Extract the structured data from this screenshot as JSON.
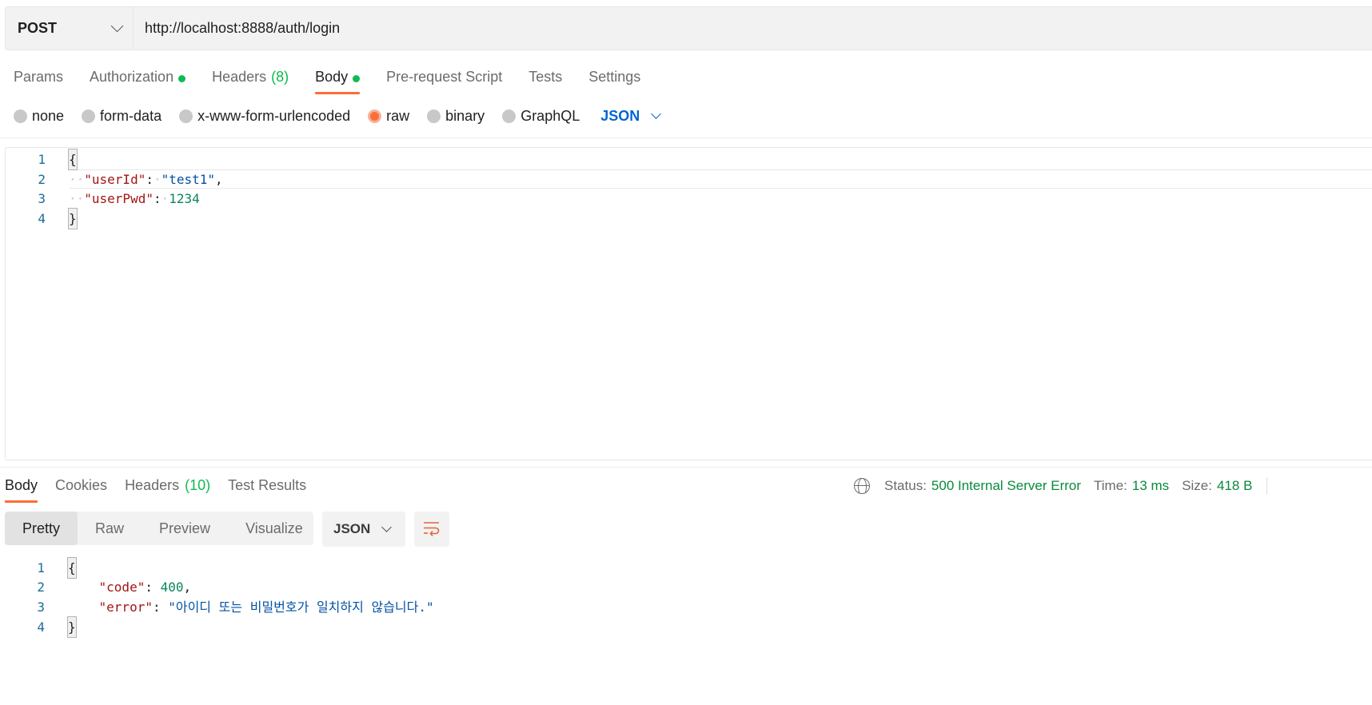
{
  "request": {
    "method": "POST",
    "url": "http://localhost:8888/auth/login"
  },
  "request_tabs": [
    {
      "label": "Params",
      "dot": false
    },
    {
      "label": "Authorization",
      "dot": true
    },
    {
      "label": "Headers",
      "count": "(8)"
    },
    {
      "label": "Body",
      "dot": true,
      "active": true
    },
    {
      "label": "Pre-request Script"
    },
    {
      "label": "Tests"
    },
    {
      "label": "Settings"
    }
  ],
  "body_types": [
    {
      "label": "none",
      "checked": false
    },
    {
      "label": "form-data",
      "checked": false
    },
    {
      "label": "x-www-form-urlencoded",
      "checked": false
    },
    {
      "label": "raw",
      "checked": true
    },
    {
      "label": "binary",
      "checked": false
    },
    {
      "label": "GraphQL",
      "checked": false
    }
  ],
  "raw_language": "JSON",
  "request_body": {
    "line_numbers": [
      "1",
      "2",
      "3",
      "4"
    ],
    "open_brace": "{",
    "close_brace": "}",
    "key1": "\"userId\"",
    "val1": "\"test1\"",
    "key2": "\"userPwd\"",
    "val2": "1234"
  },
  "response_tabs": [
    {
      "label": "Body",
      "active": true
    },
    {
      "label": "Cookies"
    },
    {
      "label": "Headers",
      "count": "(10)"
    },
    {
      "label": "Test Results"
    }
  ],
  "response_status": {
    "status_label": "Status:",
    "status_value": "500 Internal Server Error",
    "time_label": "Time:",
    "time_value": "13 ms",
    "size_label": "Size:",
    "size_value": "418 B"
  },
  "view_modes": [
    "Pretty",
    "Raw",
    "Preview",
    "Visualize"
  ],
  "response_format": "JSON",
  "response_body": {
    "line_numbers": [
      "1",
      "2",
      "3",
      "4"
    ],
    "open_brace": "{",
    "close_brace": "}",
    "key1": "\"code\"",
    "val1": "400",
    "key2": "\"error\"",
    "val2": "\"아이디 또는 비밀번호가 일치하지 않습니다.\""
  },
  "colors": {
    "accent": "#ff6c37",
    "status_ok_dot": "#0cbb52",
    "link_blue": "#0265d2"
  }
}
